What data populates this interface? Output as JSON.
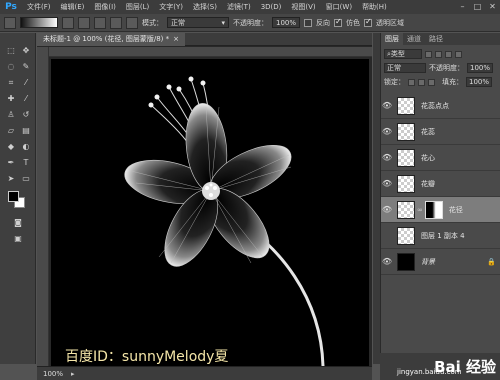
{
  "app": {
    "logo": "Ps"
  },
  "menu": {
    "items": [
      "文件(F)",
      "编辑(E)",
      "图像(I)",
      "图层(L)",
      "文字(Y)",
      "选择(S)",
      "滤镜(T)",
      "3D(D)",
      "视图(V)",
      "窗口(W)",
      "帮助(H)"
    ]
  },
  "window_controls": {
    "minimize": "–",
    "maximize": "□",
    "close": "✕"
  },
  "options": {
    "mode_label": "模式：",
    "mode_value": "正常",
    "opacity_label": "不透明度：",
    "opacity_value": "100%",
    "reverse_label": "反向",
    "dither_label": "仿色",
    "transparency_label": "透明区域"
  },
  "document": {
    "tab_title": "未标题-1 @ 100% (花径, 图层蒙版/8) *",
    "tab_close": "×",
    "zoom": "100%",
    "watermark": "百度ID：sunnyMelody夏"
  },
  "layers_panel": {
    "tabs": [
      "图层",
      "通道",
      "路径"
    ],
    "filter_label": "类型",
    "blend_mode": "正常",
    "opacity_label": "不透明度：",
    "opacity_value": "100%",
    "lock_label": "锁定：",
    "fill_label": "填充：",
    "fill_value": "100%",
    "layers": [
      {
        "name": "花蕊点点",
        "visible": true,
        "selected": false
      },
      {
        "name": "花蕊",
        "visible": true,
        "selected": false
      },
      {
        "name": "花心",
        "visible": true,
        "selected": false
      },
      {
        "name": "花瓣",
        "visible": true,
        "selected": false
      },
      {
        "name": "花径",
        "visible": true,
        "selected": true
      },
      {
        "name": "图层 1 副本 4",
        "visible": false,
        "selected": false
      },
      {
        "name": "背景",
        "visible": true,
        "selected": false
      }
    ]
  },
  "baidu": {
    "logo": "Bai 经验",
    "url": "jingyan.baidu.com"
  }
}
